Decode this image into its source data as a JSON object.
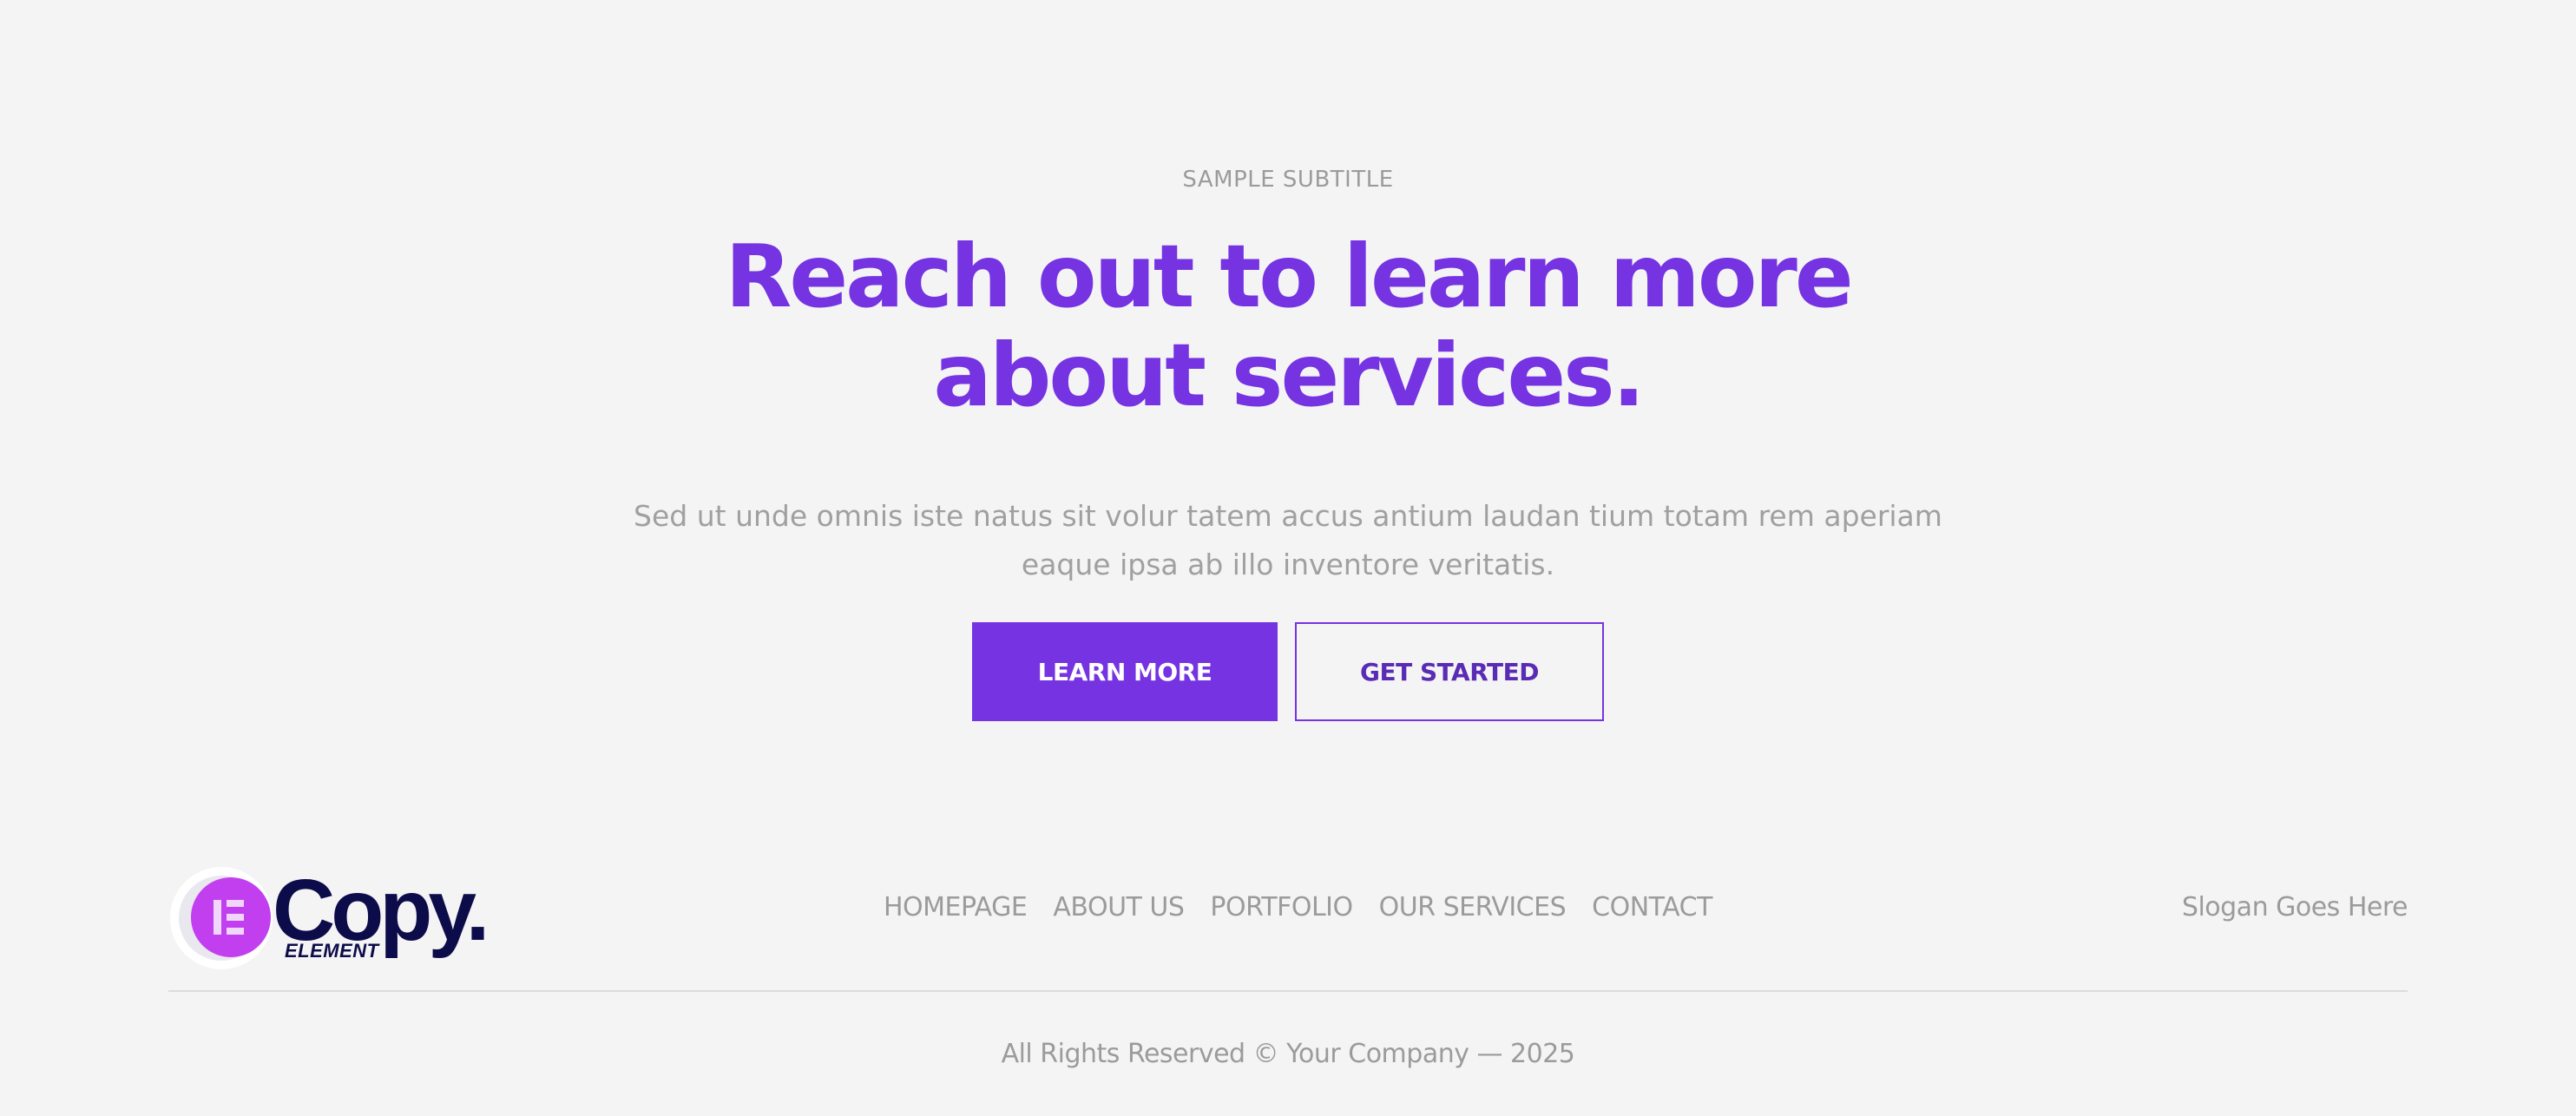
{
  "hero": {
    "subtitle": "SAMPLE SUBTITLE",
    "headline_line1": "Reach out to learn more",
    "headline_line2": "about services.",
    "lead_line1": "Sed ut unde omnis iste natus sit volur tatem accus antium laudan tium totam rem aperiam",
    "lead_line2": "eaque ipsa ab illo inventore veritatis.",
    "primary_button": "LEARN MORE",
    "secondary_button": "GET STARTED"
  },
  "footer": {
    "logo": {
      "icon": "elementor-logo-icon",
      "word": "Copy.",
      "tag": "ELEMENT"
    },
    "nav": [
      {
        "label": "HOMEPAGE"
      },
      {
        "label": "ABOUT US"
      },
      {
        "label": "PORTFOLIO"
      },
      {
        "label": "OUR SERVICES"
      },
      {
        "label": "CONTACT"
      }
    ],
    "slogan": "Slogan Goes Here",
    "copyright": "All Rights Reserved © Your Company — 2025"
  },
  "colors": {
    "accent": "#7533e2",
    "background": "#f4f4f5",
    "muted_text": "#9b9b9b",
    "logo_navy": "#0d0c4a",
    "logo_magenta": "#c23ff0"
  }
}
